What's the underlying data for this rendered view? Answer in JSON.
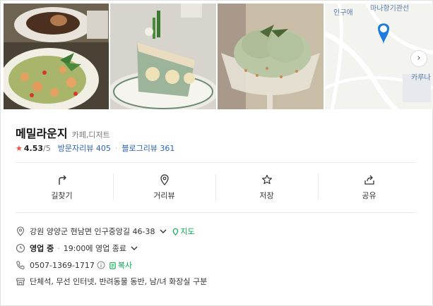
{
  "place": {
    "name": "메밀라운지",
    "category": "카페,디저트",
    "rating_star": "★",
    "rating": "4.53",
    "rating_max": "/5",
    "visitor_reviews": "방문자리뷰 405",
    "separator": "·",
    "blog_reviews": "블로그리뷰 361"
  },
  "map": {
    "labels": [
      "인구애",
      "마나항기관선",
      "카루나"
    ],
    "next_icon": "chevron-right-icon"
  },
  "actions": [
    {
      "label": "길찾기",
      "icon": "directions-icon"
    },
    {
      "label": "거리뷰",
      "icon": "pin-icon"
    },
    {
      "label": "저장",
      "icon": "star-icon"
    },
    {
      "label": "공유",
      "icon": "share-icon"
    }
  ],
  "info": {
    "address": "강원 양양군 현남면 인구중앙길 46-38",
    "map_link": "지도",
    "status": "영업 중",
    "status_dot": "·",
    "hours": "19:00에 영업 종료",
    "phone": "0507-1369-1717",
    "copy": "복사",
    "amenities": "단체석, 무선 인터넷, 반려동물 동반, 남/녀 화장실 구분"
  },
  "colors": {
    "accent_blue": "#2b62b9",
    "accent_green": "#03a94d",
    "star_red": "#ff4a3d",
    "map_pin": "#1e7be0"
  }
}
